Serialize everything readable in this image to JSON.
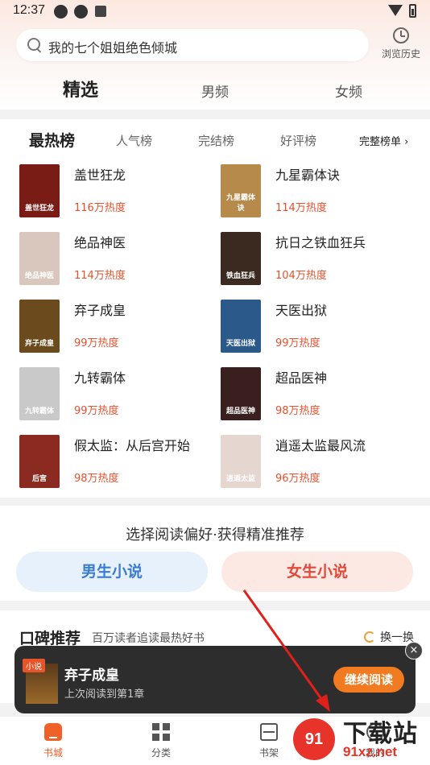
{
  "status_bar": {
    "time": "12:37"
  },
  "search": {
    "placeholder": "我的七个姐姐绝色倾城",
    "history_label": "浏览历史"
  },
  "main_tabs": [
    {
      "label": "精选"
    },
    {
      "label": "男频"
    },
    {
      "label": "女频"
    }
  ],
  "rank_tabs": [
    {
      "label": "最热榜"
    },
    {
      "label": "人气榜"
    },
    {
      "label": "完结榜"
    },
    {
      "label": "好评榜"
    }
  ],
  "rank_more": "完整榜单 ›",
  "books": [
    {
      "title": "盖世狂龙",
      "heat": "116万热度",
      "cover_text": "盖世狂龙",
      "cover_color": "#7a1c16"
    },
    {
      "title": "九星霸体诀",
      "heat": "114万热度",
      "cover_text": "九星霸体诀",
      "cover_color": "#b58a4a"
    },
    {
      "title": "绝品神医",
      "heat": "114万热度",
      "cover_text": "绝品神医",
      "cover_color": "#d9c6bd"
    },
    {
      "title": "抗日之铁血狂兵",
      "heat": "104万热度",
      "cover_text": "铁血狂兵",
      "cover_color": "#3a2a20"
    },
    {
      "title": "弃子成皇",
      "heat": "99万热度",
      "cover_text": "弃子成皇",
      "cover_color": "#6b4a1e"
    },
    {
      "title": "天医出狱",
      "heat": "99万热度",
      "cover_text": "天医出狱",
      "cover_color": "#2b5a8a"
    },
    {
      "title": "九转霸体",
      "heat": "99万热度",
      "cover_text": "九转霸体",
      "cover_color": "#c9c9c9"
    },
    {
      "title": "超品医神",
      "heat": "98万热度",
      "cover_text": "超品医神",
      "cover_color": "#3a1f1f"
    },
    {
      "title": "假太监：从后宫开始",
      "heat": "98万热度",
      "cover_text": "后宫",
      "cover_color": "#8a2a20"
    },
    {
      "title": "逍遥太监最风流",
      "heat": "96万热度",
      "cover_text": "逍遥太监",
      "cover_color": "#e6d6d0"
    }
  ],
  "preference": {
    "title": "选择阅读偏好·获得精准推荐",
    "male": "男生小说",
    "female": "女生小说"
  },
  "recommend": {
    "title": "口碑推荐",
    "subtitle": "百万读者追读最热好书",
    "swap": "换一换"
  },
  "continue_reading": {
    "tag": "小说",
    "book": "弃子成皇",
    "progress": "上次阅读到第1章",
    "button": "继续阅读",
    "close": "×"
  },
  "nav": [
    {
      "label": "书城"
    },
    {
      "label": "分类"
    },
    {
      "label": "书架"
    },
    {
      "label": "我的"
    }
  ],
  "watermark": {
    "logo": "91",
    "text": "下载站",
    "url": "91xz.net"
  },
  "colors": {
    "accent": "#f0612a",
    "heat": "#e2522e",
    "male": "#3b7bd4",
    "female": "#e04a3a"
  }
}
